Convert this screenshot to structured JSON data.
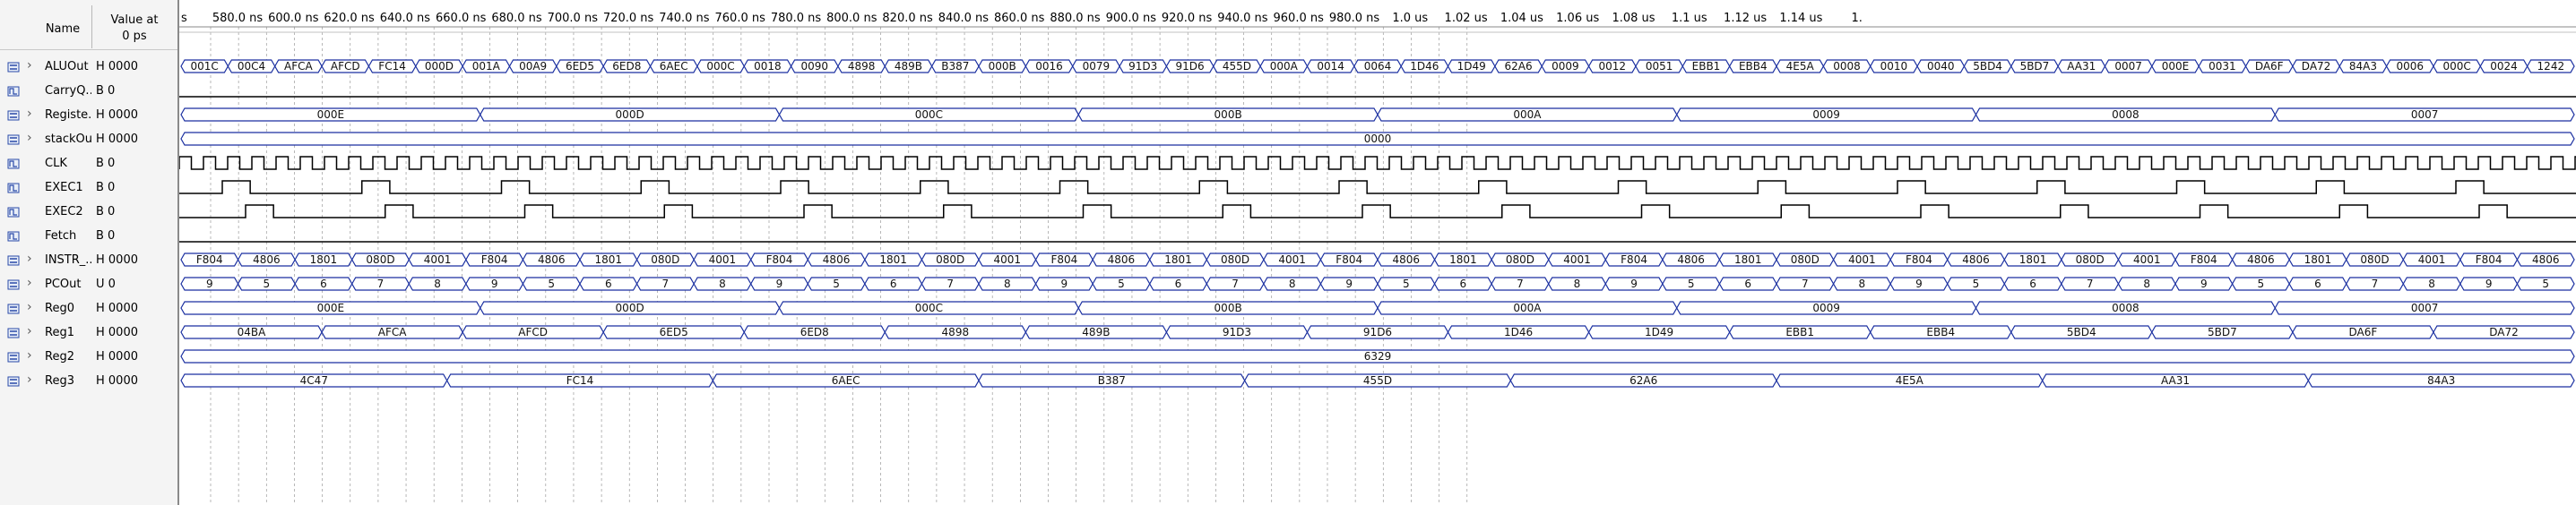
{
  "header": {
    "name_label": "Name",
    "value_label": "Value at",
    "value_time": "0 ps"
  },
  "colors": {
    "wave": "#1a2fa0",
    "clock": "#000000",
    "grid": "#9a9a9a"
  },
  "ruler": {
    "labels": [
      "s",
      "580.0 ns",
      "600.0 ns",
      "620.0 ns",
      "640.0 ns",
      "660.0 ns",
      "680.0 ns",
      "700.0 ns",
      "720.0 ns",
      "740.0 ns",
      "760.0 ns",
      "780.0 ns",
      "800.0 ns",
      "820.0 ns",
      "840.0 ns",
      "860.0 ns",
      "880.0 ns",
      "900.0 ns",
      "920.0 ns",
      "940.0 ns",
      "960.0 ns",
      "980.0 ns",
      "1.0 us",
      "1.02 us",
      "1.04 us",
      "1.06 us",
      "1.08 us",
      "1.1 us",
      "1.12 us",
      "1.14 us",
      "1."
    ]
  },
  "signals": [
    {
      "name": "ALUOut",
      "value": "H 0000",
      "expandable": true,
      "type": "bus",
      "icon": "bus-icon",
      "segments": [
        "001C",
        "00C4",
        "AFCA",
        "AFCD",
        "FC14",
        "000D",
        "001A",
        "00A9",
        "6ED5",
        "6ED8",
        "6AEC",
        "000C",
        "0018",
        "0090",
        "4898",
        "489B",
        "B387",
        "000B",
        "0016",
        "0079",
        "91D3",
        "91D6",
        "455D",
        "000A",
        "0014",
        "0064",
        "1D46",
        "1D49",
        "62A6",
        "0009",
        "0012",
        "0051",
        "EBB1",
        "EBB4",
        "4E5A",
        "0008",
        "0010",
        "0040",
        "5BD4",
        "5BD7",
        "AA31",
        "0007",
        "000E",
        "0031",
        "DA6F",
        "DA72",
        "84A3",
        "0006",
        "000C",
        "0024",
        "1242"
      ]
    },
    {
      "name": "CarryQ...",
      "value": "B 0",
      "expandable": false,
      "type": "bit",
      "icon": "bit-icon",
      "level": "low"
    },
    {
      "name": "Registe...",
      "value": "H 0000",
      "expandable": true,
      "type": "bus",
      "icon": "bus-icon",
      "segments": [
        "000E",
        "000D",
        "000C",
        "000B",
        "000A",
        "0009",
        "0008",
        "0007"
      ]
    },
    {
      "name": "stackOut",
      "value": "H 0000",
      "expandable": true,
      "type": "bus",
      "icon": "bus-icon",
      "segments": [
        "0000"
      ]
    },
    {
      "name": "CLK",
      "value": "B 0",
      "expandable": false,
      "type": "clock",
      "icon": "bit-icon"
    },
    {
      "name": "EXEC1",
      "value": "B 0",
      "expandable": false,
      "type": "bit",
      "icon": "bit-icon",
      "level": "pulse"
    },
    {
      "name": "EXEC2",
      "value": "B 0",
      "expandable": false,
      "type": "bit",
      "icon": "bit-icon",
      "level": "pulse"
    },
    {
      "name": "Fetch",
      "value": "B 0",
      "expandable": false,
      "type": "bit",
      "icon": "bit-icon",
      "level": "low"
    },
    {
      "name": "INSTR_...",
      "value": "H 0000",
      "expandable": true,
      "type": "bus",
      "icon": "bus-icon",
      "segments": [
        "F804",
        "4806",
        "1801",
        "080D",
        "4001",
        "F804",
        "4806",
        "1801",
        "080D",
        "4001",
        "F804",
        "4806",
        "1801",
        "080D",
        "4001",
        "F804",
        "4806",
        "1801",
        "080D",
        "4001",
        "F804",
        "4806",
        "1801",
        "080D",
        "4001",
        "F804",
        "4806",
        "1801",
        "080D",
        "4001",
        "F804",
        "4806",
        "1801",
        "080D",
        "4001",
        "F804",
        "4806",
        "1801",
        "080D",
        "4001",
        "F804",
        "4806"
      ]
    },
    {
      "name": "PCOut",
      "value": "U 0",
      "expandable": true,
      "type": "bus",
      "icon": "bus-icon",
      "segments": [
        "9",
        "5",
        "6",
        "7",
        "8",
        "9",
        "5",
        "6",
        "7",
        "8",
        "9",
        "5",
        "6",
        "7",
        "8",
        "9",
        "5",
        "6",
        "7",
        "8",
        "9",
        "5",
        "6",
        "7",
        "8",
        "9",
        "5",
        "6",
        "7",
        "8",
        "9",
        "5",
        "6",
        "7",
        "8",
        "9",
        "5",
        "6",
        "7",
        "8",
        "9",
        "5"
      ]
    },
    {
      "name": "Reg0",
      "value": "H 0000",
      "expandable": true,
      "type": "bus",
      "icon": "bus-icon",
      "segments": [
        "000E",
        "000D",
        "000C",
        "000B",
        "000A",
        "0009",
        "0008",
        "0007"
      ]
    },
    {
      "name": "Reg1",
      "value": "H 0000",
      "expandable": true,
      "type": "bus",
      "icon": "bus-icon",
      "segments": [
        "04BA",
        "AFCA",
        "AFCD",
        "6ED5",
        "6ED8",
        "4898",
        "489B",
        "91D3",
        "91D6",
        "1D46",
        "1D49",
        "EBB1",
        "EBB4",
        "5BD4",
        "5BD7",
        "DA6F",
        "DA72"
      ]
    },
    {
      "name": "Reg2",
      "value": "H 0000",
      "expandable": true,
      "type": "bus",
      "icon": "bus-icon",
      "segments": [
        "6329"
      ]
    },
    {
      "name": "Reg3",
      "value": "H 0000",
      "expandable": true,
      "type": "bus",
      "icon": "bus-icon",
      "segments": [
        "4C47",
        "FC14",
        "6AEC",
        "B387",
        "455D",
        "62A6",
        "4E5A",
        "AA31",
        "84A3"
      ]
    }
  ]
}
